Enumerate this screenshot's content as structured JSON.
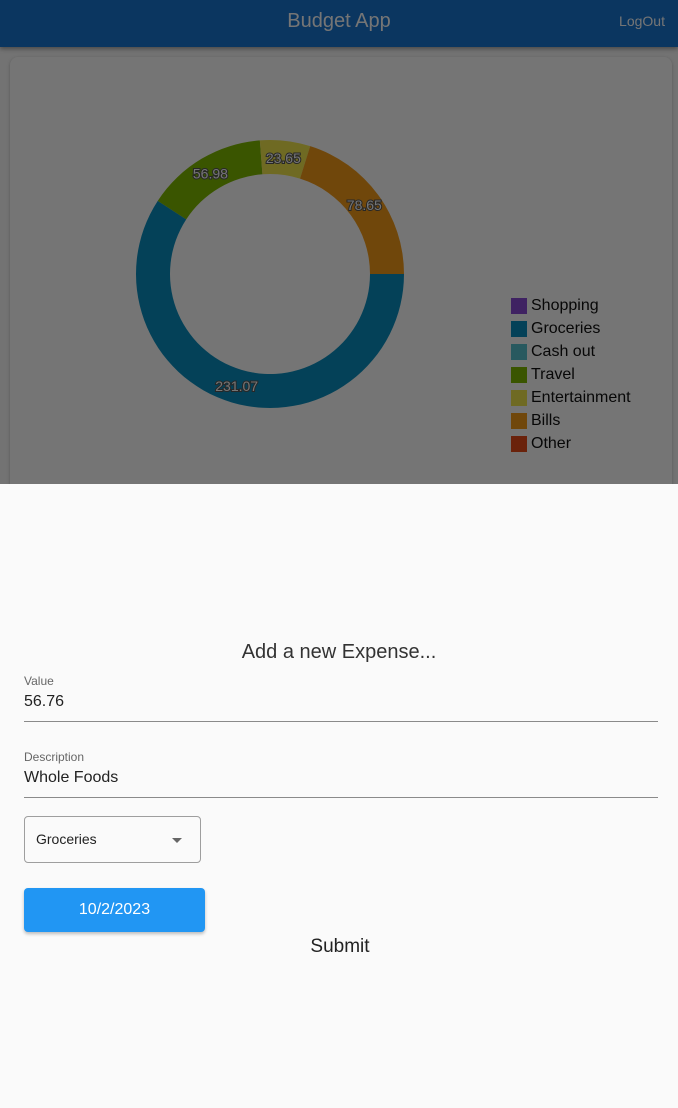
{
  "appbar": {
    "title": "Budget App",
    "logout_label": "LogOut",
    "color": "#1976d2"
  },
  "chart_data": {
    "type": "pie",
    "variant": "donut",
    "legend_position": "right",
    "slices": [
      {
        "category": "Groceries",
        "value": 231.07,
        "color": "#0a8fbf"
      },
      {
        "category": "Travel",
        "value": 56.98,
        "color": "#7fba00"
      },
      {
        "category": "Entertainment",
        "value": 23.65,
        "color": "#f2e64d"
      },
      {
        "category": "Bills",
        "value": 78.65,
        "color": "#f59c1a"
      }
    ],
    "legend": [
      {
        "label": "Shopping",
        "color": "#8a4bd6"
      },
      {
        "label": "Groceries",
        "color": "#0a8fbf"
      },
      {
        "label": "Cash out",
        "color": "#58c3cf"
      },
      {
        "label": "Travel",
        "color": "#7fba00"
      },
      {
        "label": "Entertainment",
        "color": "#f2e64d"
      },
      {
        "label": "Bills",
        "color": "#f59c1a"
      },
      {
        "label": "Other",
        "color": "#e64a19"
      }
    ]
  },
  "form": {
    "heading": "Add a new Expense...",
    "value_label": "Value",
    "value": "56.76",
    "description_label": "Description",
    "description": "Whole Foods",
    "category": "Groceries",
    "date": "10/2/2023",
    "submit_label": "Submit"
  }
}
